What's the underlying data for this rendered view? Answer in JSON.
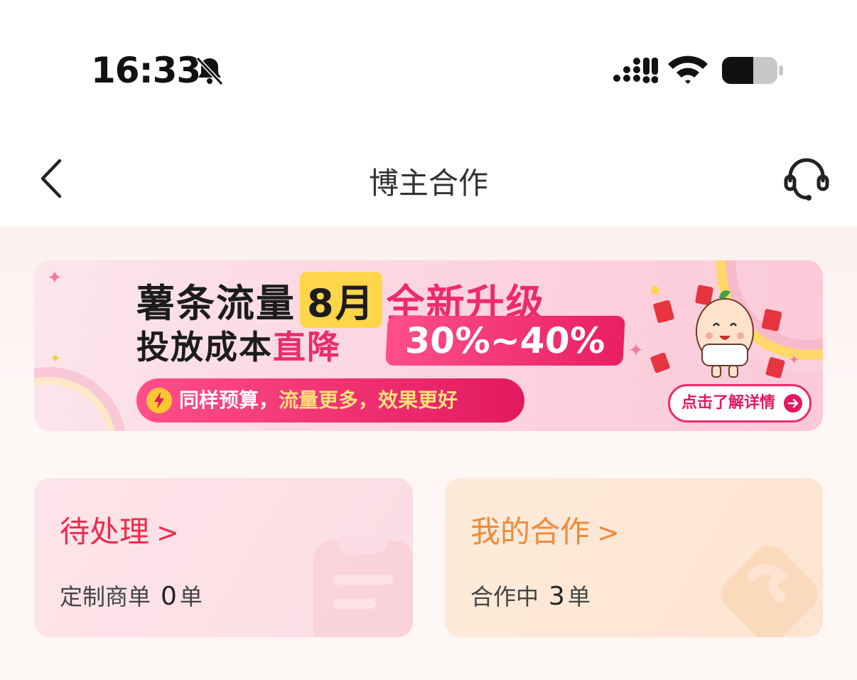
{
  "status_bar": {
    "time": "16:33",
    "icons": [
      "bell-slash-icon",
      "signal-icon",
      "wifi-icon",
      "battery-icon"
    ]
  },
  "nav": {
    "title": "博主合作",
    "back_icon": "chevron-left-icon",
    "service_icon": "headset-icon"
  },
  "banner": {
    "line1_prefix": "薯条流量",
    "line1_month": "8月",
    "line1_upgrade": "全新升级",
    "line2_prefix": "投放成本",
    "line2_drop": "直降",
    "percent": "30%~40%",
    "pill_part1": "同样预算，",
    "pill_part2": "流量更多，效果更好",
    "cta": "点击了解详情",
    "colors": {
      "accent": "#ee2a6a",
      "highlight": "#ffd54a"
    }
  },
  "cards": {
    "pending": {
      "title": "待处理",
      "chevron": ">",
      "sub_label": "定制商单",
      "count": "0",
      "unit": "单",
      "color": "#ee2b4a"
    },
    "coop": {
      "title": "我的合作",
      "chevron": ">",
      "sub_label": "合作中",
      "count": "3",
      "unit": "单",
      "color": "#f08a3a"
    }
  }
}
